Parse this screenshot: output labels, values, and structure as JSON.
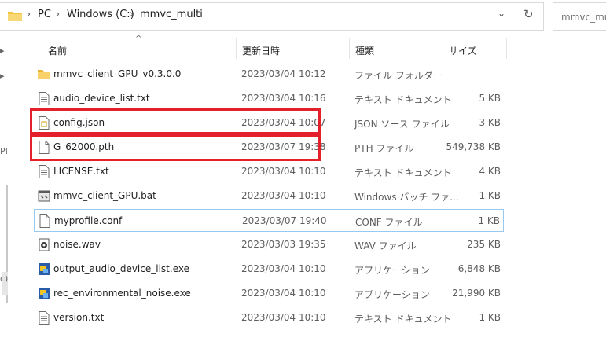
{
  "address": {
    "crumbs": [
      "PC",
      "Windows (C:)",
      "mmvc_multi"
    ],
    "search_placeholder": "mmvc_multi"
  },
  "columns": {
    "name": "名前",
    "date": "更新日時",
    "type": "種類",
    "size": "サイズ"
  },
  "files": [
    {
      "name": "mmvc_client_GPU_v0.3.0.0",
      "date": "2023/03/04 10:12",
      "type": "ファイル フォルダー",
      "size": "",
      "icon": "folder-icon"
    },
    {
      "name": "audio_device_list.txt",
      "date": "2023/03/04 10:16",
      "type": "テキスト ドキュメント",
      "size": "5 KB",
      "icon": "text-file-icon"
    },
    {
      "name": "config.json",
      "date": "2023/03/04 10:07",
      "type": "JSON ソース ファイル",
      "size": "3 KB",
      "icon": "json-file-icon"
    },
    {
      "name": "G_62000.pth",
      "date": "2023/03/07 19:38",
      "type": "PTH ファイル",
      "size": "549,738 KB",
      "icon": "blank-file-icon"
    },
    {
      "name": "LICENSE.txt",
      "date": "2023/03/04 10:10",
      "type": "テキスト ドキュメント",
      "size": "4 KB",
      "icon": "text-file-icon"
    },
    {
      "name": "mmvc_client_GPU.bat",
      "date": "2023/03/04 10:10",
      "type": "Windows バッチ ファ...",
      "size": "1 KB",
      "icon": "batch-file-icon"
    },
    {
      "name": "myprofile.conf",
      "date": "2023/03/07 19:40",
      "type": "CONF ファイル",
      "size": "1 KB",
      "icon": "blank-file-icon"
    },
    {
      "name": "noise.wav",
      "date": "2023/03/03 19:35",
      "type": "WAV ファイル",
      "size": "235 KB",
      "icon": "audio-file-icon"
    },
    {
      "name": "output_audio_device_list.exe",
      "date": "2023/03/04 10:10",
      "type": "アプリケーション",
      "size": "6,848 KB",
      "icon": "exe-file-icon"
    },
    {
      "name": "rec_environmental_noise.exe",
      "date": "2023/03/04 10:10",
      "type": "アプリケーション",
      "size": "21,990 KB",
      "icon": "exe-file-icon"
    },
    {
      "name": "version.txt",
      "date": "2023/03/04 10:10",
      "type": "テキスト ドキュメント",
      "size": "1 KB",
      "icon": "text-file-icon"
    }
  ],
  "left_nav_fragments": [
    "PI",
    "c)"
  ],
  "colors": {
    "highlight_box": "#e3212d",
    "row_outline": "#99c9ef",
    "folder": "#f4c542"
  }
}
